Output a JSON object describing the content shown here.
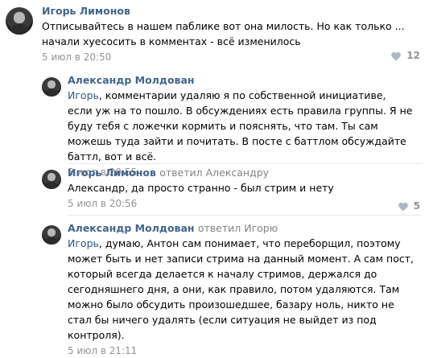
{
  "comments": [
    {
      "author": "Игорь Лимонов",
      "reply_to": "",
      "text": "Отписывайтесь в нашем паблике вот она милость. Но как только ... начали хуесосить в комментах - всё изменилось",
      "date": "5 июл в 20:50",
      "likes": "12"
    },
    {
      "author": "Александр Молдован",
      "reply_to": "",
      "text_mention": "Игорь",
      "text": ", комментарии удаляю я по собственной инициативе, если уж на то пошло. В обсуждениях есть правила группы. Я не буду тебя с ложечки кормить и пояснять, что там. Ты сам можешь туда зайти и почитать. В посте с баттлом обсуждайте баттл, вот и всё.",
      "date": "5 июл в 20:55",
      "likes": ""
    },
    {
      "author": "Игорь Лимонов",
      "reply_to": "ответил Александру",
      "text": "Александр, да просто странно - был стрим и нету",
      "date": "5 июл в 20:56",
      "likes": "5"
    },
    {
      "author": "Александр Молдован",
      "reply_to": "ответил Игорю",
      "text_mention": "Игорь",
      "text": ", думаю, Антон сам понимает, что переборщил, поэтому может быть и нет записи стрима на данный момент. А сам пост, который всегда делается к началу стримов, держался до сегодняшнего дня, а они, как правило, потом удаляются. Там можно было обсудить произошедшее, базару ноль, никто не стал бы ничего удалять (если ситуация не выйдет из под контроля).",
      "date": "5 июл в 21:11",
      "likes": ""
    }
  ],
  "icons": {
    "like": "heart-icon"
  },
  "colors": {
    "author": "#42648b",
    "meta": "#939393",
    "mention": "#2a5885",
    "separator": "#e7e8ec"
  }
}
